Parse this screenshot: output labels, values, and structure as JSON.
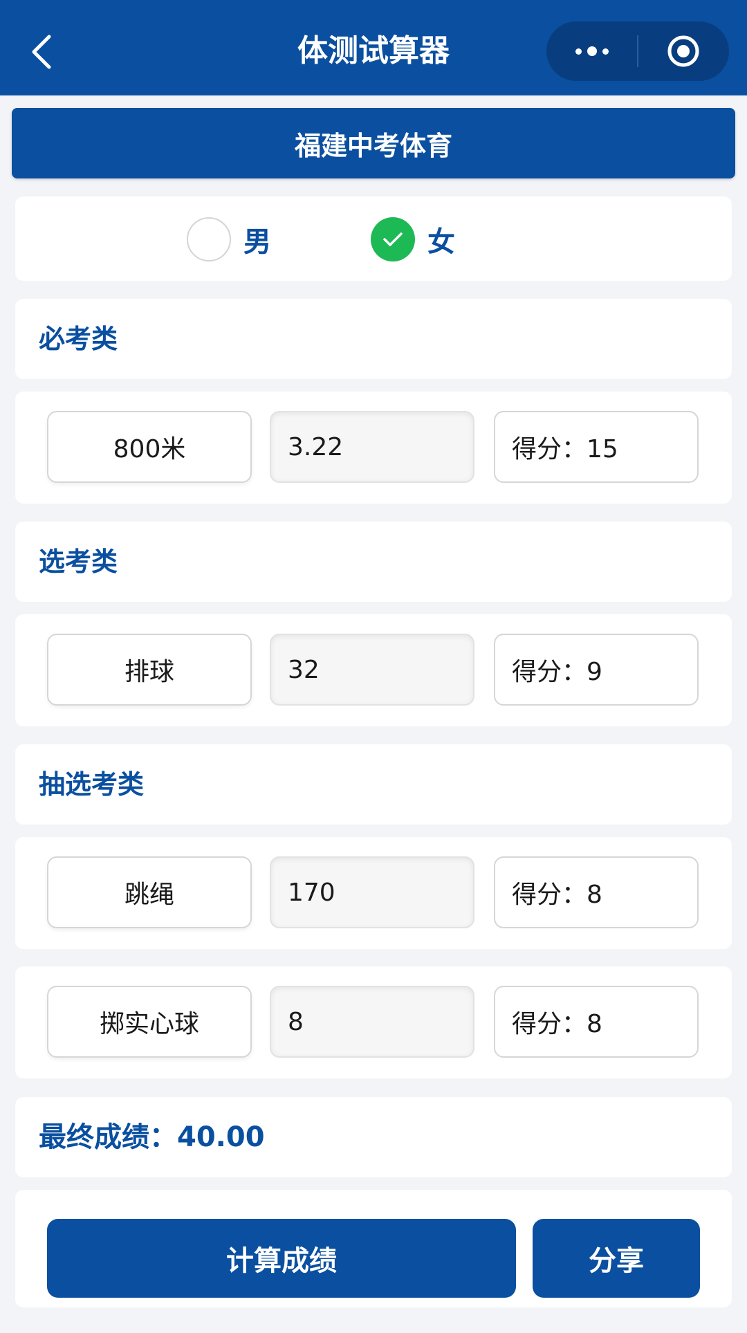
{
  "nav": {
    "title": "体测试算器",
    "icons": {
      "back": "chevron-left-icon",
      "more": "more-dots-icon",
      "close": "target-circle-icon"
    }
  },
  "header": {
    "title": "福建中考体育"
  },
  "gender": {
    "male_label": "男",
    "female_label": "女",
    "selected": "女"
  },
  "sections": {
    "required": {
      "title": "必考类",
      "items": [
        {
          "name": "800米",
          "value": "3.22",
          "score": "得分：15"
        }
      ]
    },
    "optional": {
      "title": "选考类",
      "items": [
        {
          "name": "排球",
          "value": "32",
          "score": "得分：9"
        }
      ]
    },
    "drawn": {
      "title": "抽选考类",
      "items": [
        {
          "name": "跳绳",
          "value": "170",
          "score": "得分：8"
        },
        {
          "name": "掷实心球",
          "value": "8",
          "score": "得分：8"
        }
      ]
    }
  },
  "result": {
    "text": "最终成绩：40.00"
  },
  "actions": {
    "calculate_label": "计算成绩",
    "share_label": "分享"
  },
  "colors": {
    "primary": "#0a4fa0",
    "check_green": "#1db954",
    "background": "#f3f4f8"
  }
}
